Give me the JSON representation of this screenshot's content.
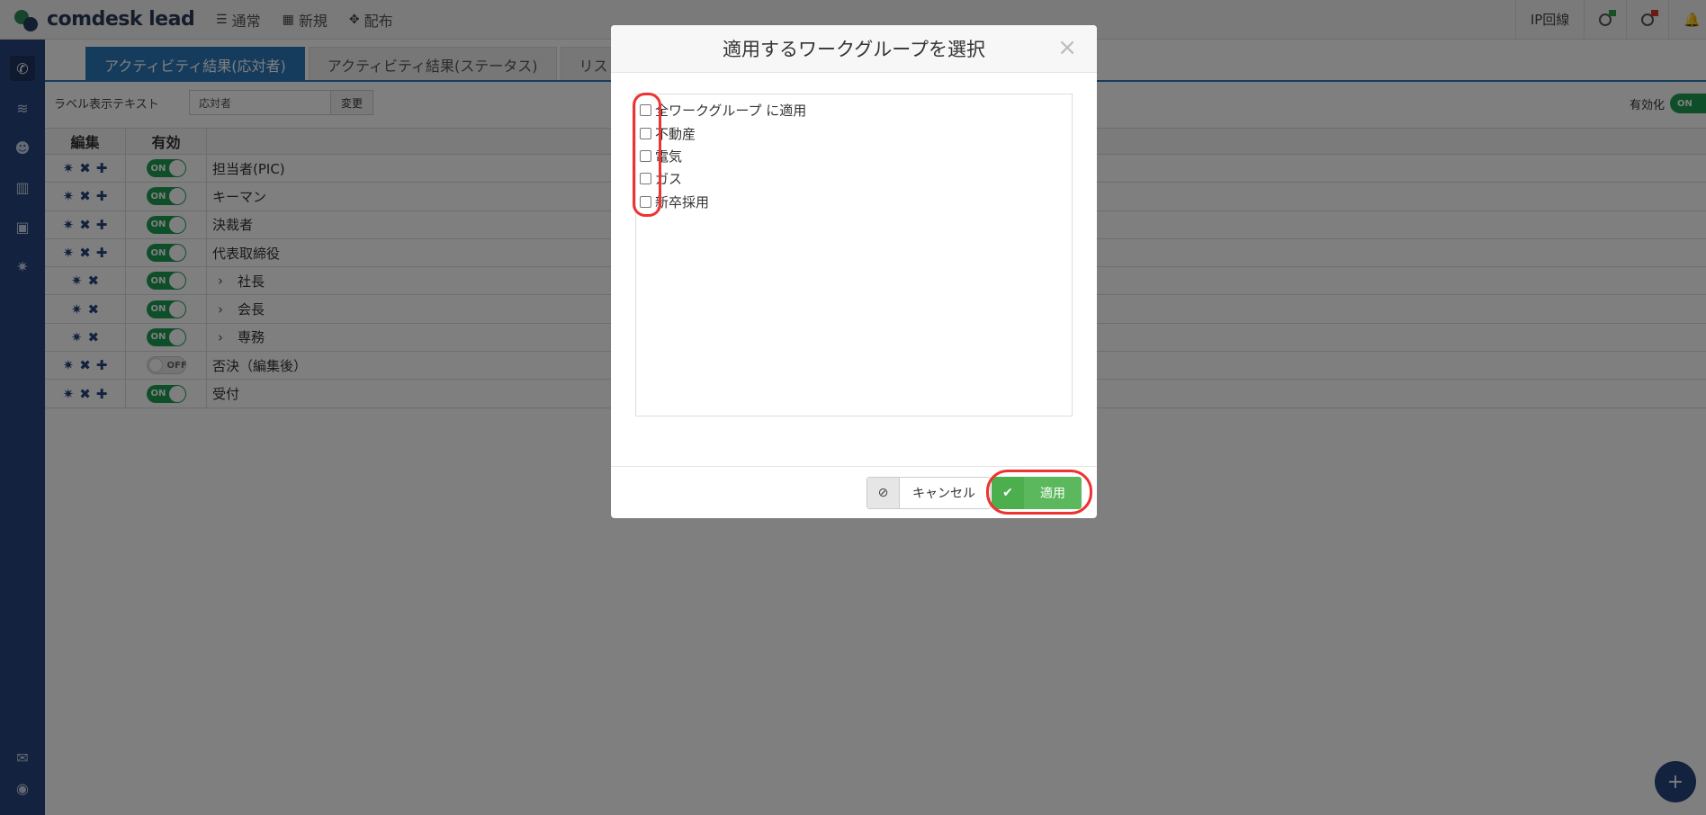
{
  "app": {
    "name": "comdesk lead"
  },
  "topnav": [
    {
      "icon": "list-icon",
      "glyph": "☰",
      "label": "通常"
    },
    {
      "icon": "grid-icon",
      "glyph": "▦",
      "label": "新規"
    },
    {
      "icon": "distribute-icon",
      "glyph": "✥",
      "label": "配布"
    }
  ],
  "top_right": {
    "ip_label": "IP回線"
  },
  "sidebar": {
    "items": [
      {
        "icon": "phone-icon",
        "glyph": "✆"
      },
      {
        "icon": "database-icon",
        "glyph": "≋"
      },
      {
        "icon": "users-icon",
        "glyph": "☻"
      },
      {
        "icon": "chart-icon",
        "glyph": "▥"
      },
      {
        "icon": "board-icon",
        "glyph": "▣"
      },
      {
        "icon": "gear-icon",
        "glyph": "✷"
      }
    ],
    "bottom": [
      {
        "icon": "chat-icon",
        "glyph": "✉"
      },
      {
        "icon": "profile-icon",
        "glyph": "◉"
      }
    ]
  },
  "tabs": [
    {
      "label": "アクティビティ結果(応対者)",
      "active": true
    },
    {
      "label": "アクティビティ結果(ステータス)",
      "active": false
    },
    {
      "label": "リスト",
      "active": false
    }
  ],
  "label_row": {
    "label": "ラベル表示テキスト",
    "input_value": "応対者",
    "change_button": "変更",
    "enable_label": "有効化",
    "enable_state": "ON"
  },
  "table": {
    "headers": {
      "edit": "編集",
      "enabled": "有効"
    },
    "rows": [
      {
        "name": "担当者(PIC)",
        "enabled": "ON",
        "child": false,
        "can_add": true
      },
      {
        "name": "キーマン",
        "enabled": "ON",
        "child": false,
        "can_add": true
      },
      {
        "name": "決裁者",
        "enabled": "ON",
        "child": false,
        "can_add": true
      },
      {
        "name": "代表取締役",
        "enabled": "ON",
        "child": false,
        "can_add": true
      },
      {
        "name": "社長",
        "enabled": "ON",
        "child": true,
        "can_add": false
      },
      {
        "name": "会長",
        "enabled": "ON",
        "child": true,
        "can_add": false
      },
      {
        "name": "専務",
        "enabled": "ON",
        "child": true,
        "can_add": false
      },
      {
        "name": "否決（編集後）",
        "enabled": "OFF",
        "child": false,
        "can_add": true
      },
      {
        "name": "受付",
        "enabled": "ON",
        "child": false,
        "can_add": true
      }
    ]
  },
  "modal": {
    "title": "適用するワークグループを選択",
    "close": "×",
    "workgroups": [
      "全ワークグループ に適用",
      "不動産",
      "電気",
      "ガス",
      "新卒採用"
    ],
    "cancel_label": "キャンセル",
    "apply_label": "適用"
  },
  "colors": {
    "sidebar": "#27457d",
    "tab_active": "#2b79bb",
    "toggle_on": "#1c9e53",
    "apply": "#5cb85c",
    "annotation": "#e33333"
  }
}
